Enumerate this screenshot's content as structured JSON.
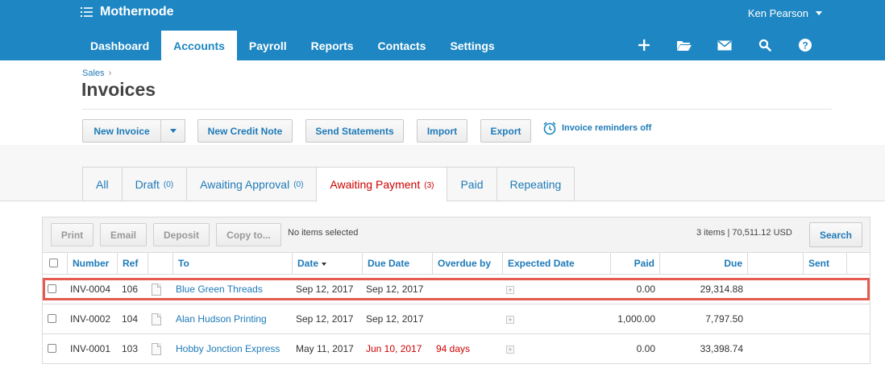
{
  "app": {
    "name": "Mothernode",
    "user": "Ken Pearson"
  },
  "nav": {
    "tabs": [
      "Dashboard",
      "Accounts",
      "Payroll",
      "Reports",
      "Contacts",
      "Settings"
    ],
    "active": "Accounts",
    "actions": [
      "plus-icon",
      "folder-icon",
      "mail-icon",
      "search-icon",
      "help-icon"
    ]
  },
  "page": {
    "breadcrumb": "Sales",
    "breadcrumb_sep": "›",
    "title": "Invoices"
  },
  "buttons": {
    "new_invoice": "New Invoice",
    "new_credit_note": "New Credit Note",
    "send_statements": "Send Statements",
    "import": "Import",
    "export": "Export",
    "reminders": "Invoice reminders off"
  },
  "status_tabs": [
    {
      "label": "All",
      "count": ""
    },
    {
      "label": "Draft",
      "count": "(0)"
    },
    {
      "label": "Awaiting Approval",
      "count": "(0)"
    },
    {
      "label": "Awaiting Payment",
      "count": "(3)"
    },
    {
      "label": "Paid",
      "count": ""
    },
    {
      "label": "Repeating",
      "count": ""
    }
  ],
  "toolbar": {
    "print": "Print",
    "email": "Email",
    "deposit": "Deposit",
    "copy_to": "Copy to...",
    "selection": "No items selected",
    "summary": "3 items  | 70,511.12  USD",
    "search": "Search"
  },
  "columns": {
    "number": "Number",
    "ref": "Ref",
    "to": "To",
    "date": "Date",
    "due_date": "Due Date",
    "overdue_by": "Overdue by",
    "expected_date": "Expected Date",
    "paid": "Paid",
    "due": "Due",
    "sent": "Sent"
  },
  "rows": [
    {
      "number": "INV-0004",
      "ref": "106",
      "to": "Blue Green Threads",
      "date": "Sep 12, 2017",
      "due_date": "Sep 12, 2017",
      "overdue_by": "",
      "paid": "0.00",
      "due": "29,314.88"
    },
    {
      "number": "INV-0002",
      "ref": "104",
      "to": "Alan Hudson Printing",
      "date": "Sep 12, 2017",
      "due_date": "Sep 12, 2017",
      "overdue_by": "",
      "paid": "1,000.00",
      "due": "7,797.50"
    },
    {
      "number": "INV-0001",
      "ref": "103",
      "to": "Hobby Jonction Express",
      "date": "May 11, 2017",
      "due_date": "Jun 10, 2017",
      "overdue_by": "94 days",
      "paid": "0.00",
      "due": "33,398.74"
    }
  ],
  "colors": {
    "primary": "#1e87c3",
    "overdue": "#cc0000",
    "highlight": "#e55b4f"
  }
}
